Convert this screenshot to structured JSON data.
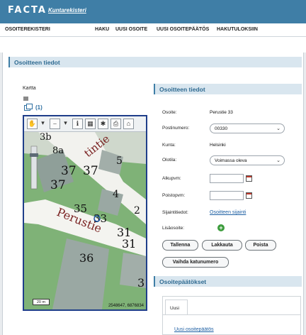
{
  "header": {
    "brand": "FACTA",
    "subtitle": "Kuntarekisteri"
  },
  "nav": {
    "left": "OSOITEREKISTERI",
    "items": [
      "HAKU",
      "UUSI OSOITE",
      "UUSI OSOITEPÄÄTÖS",
      "HAKUTULOKSIIN"
    ]
  },
  "main": {
    "title": "Osoitteen tiedot"
  },
  "map": {
    "kartta_label": "Kartta",
    "layer_count": "(1)",
    "street_labels": [
      "tintie",
      "Perustie"
    ],
    "house_numbers": [
      "3b",
      "8a",
      "37",
      "37",
      "37",
      "5",
      "4",
      "35",
      "33",
      "2",
      "31",
      "31",
      "36",
      "3"
    ],
    "scale_label": "20 m",
    "coordinates": "2548647, 6876834",
    "toolbar_icons": [
      "pan-hand-icon",
      "measure-icon",
      "info-icon",
      "print-preview-icon",
      "settings-icon",
      "print-icon",
      "home-icon"
    ]
  },
  "details": {
    "title": "Osoitteen tiedot",
    "osoite_label": "Osoite:",
    "osoite_value": "Perustie 33",
    "postinumero_label": "Postinumero:",
    "postinumero_value": "00330",
    "kunta_label": "Kunta:",
    "kunta_value": "Helsinki",
    "olotila_label": "Olotila:",
    "olotila_value": "Voimassa oleva",
    "alkupvm_label": "Alkupvm:",
    "alkupvm_value": "",
    "poistopvm_label": "Poistopvm:",
    "poistopvm_value": "",
    "sijaintitiedot_label": "Sijaintitiedot:",
    "sijaintitiedot_link": "Osoitteen sijainti",
    "lisaosoite_label": "Lisäosoite:"
  },
  "actions": {
    "save": "Tallenna",
    "cancel": "Lakkauta",
    "delete": "Poista",
    "change_street": "Vaihda katunumero"
  },
  "decisions": {
    "title": "Osoitepäätökset",
    "tab": "Uusi",
    "link": "Uusi osoitepäätös"
  },
  "colors": {
    "header": "#3f7ea6",
    "title_bar": "#d9e6ef",
    "link": "#1d5fa3",
    "map_border": "#1f3e8a"
  }
}
